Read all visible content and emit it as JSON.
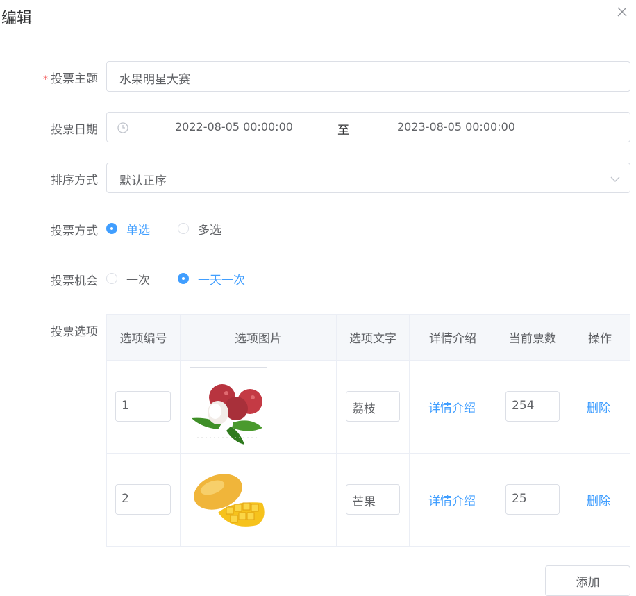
{
  "dialog": {
    "title": "编辑"
  },
  "form": {
    "subject": {
      "label": "投票主题",
      "required_mark": "*",
      "value": "水果明星大赛"
    },
    "date": {
      "label": "投票日期",
      "start": "2022-08-05 00:00:00",
      "separator": "至",
      "end": "2023-08-05 00:00:00"
    },
    "sort": {
      "label": "排序方式",
      "value": "默认正序"
    },
    "vote_type": {
      "label": "投票方式",
      "options": [
        "单选",
        "多选"
      ],
      "selected": "单选"
    },
    "chance": {
      "label": "投票机会",
      "options": [
        "一次",
        "一天一次"
      ],
      "selected": "一天一次"
    },
    "options": {
      "label": "投票选项"
    }
  },
  "table": {
    "headers": [
      "选项编号",
      "选项图片",
      "选项文字",
      "详情介绍",
      "当前票数",
      "操作"
    ],
    "rows": [
      {
        "number": "1",
        "image": "lychee",
        "text": "荔枝",
        "detail": "详情介绍",
        "votes": "254",
        "action": "删除"
      },
      {
        "number": "2",
        "image": "mango",
        "text": "芒果",
        "detail": "详情介绍",
        "votes": "25",
        "action": "删除"
      }
    ]
  },
  "actions": {
    "add_label": "添加"
  },
  "colors": {
    "primary": "#409eff",
    "required": "#f56c6c",
    "border": "#dcdfe6"
  }
}
